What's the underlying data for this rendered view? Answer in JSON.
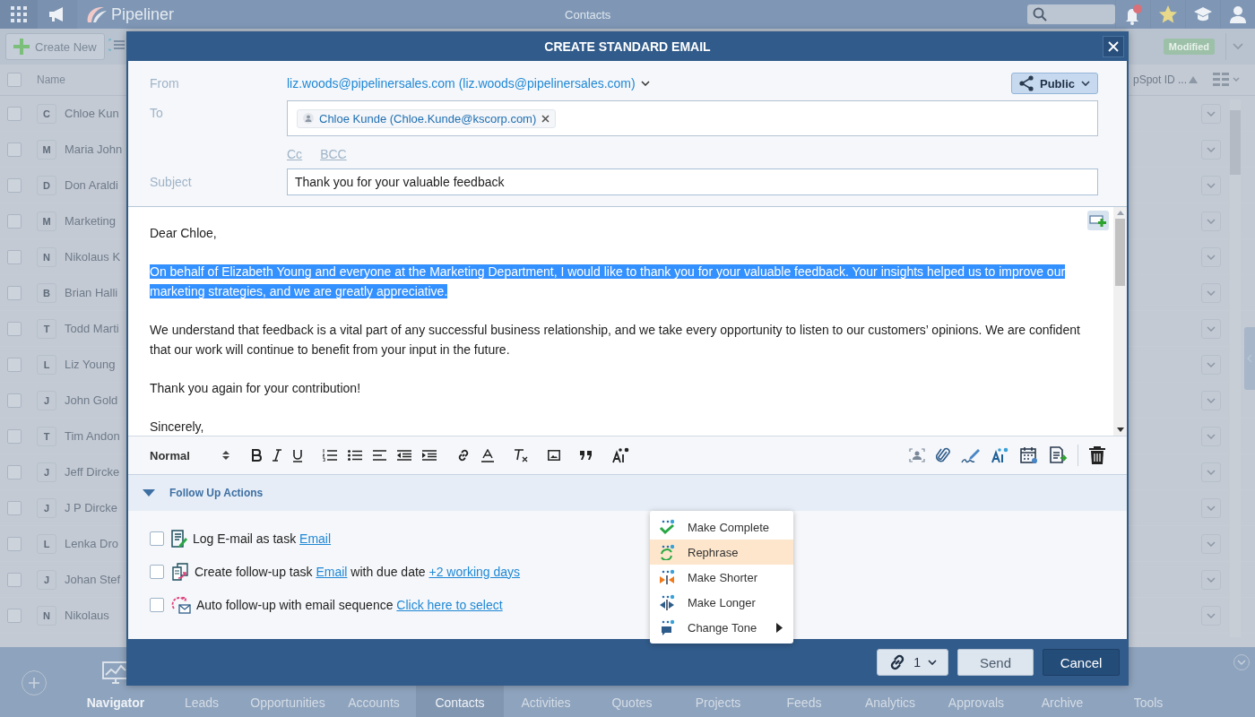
{
  "app": {
    "logo": "Pipeliner",
    "page_title": "Contacts",
    "toolbar": {
      "create_new": "Create New",
      "status": "Modified"
    },
    "list": {
      "select_all_checked": false,
      "name_column": "Name",
      "id_column": "pSpot ID ...",
      "rows": [
        {
          "initial": "C",
          "name": "Chloe Kun",
          "checked": false
        },
        {
          "initial": "M",
          "name": "Maria John",
          "checked": false
        },
        {
          "initial": "D",
          "name": "Don Araldi",
          "checked": false
        },
        {
          "initial": "M",
          "name": "Marketing",
          "checked": false
        },
        {
          "initial": "N",
          "name": "Nikolaus K",
          "checked": false
        },
        {
          "initial": "B",
          "name": "Brian Halli",
          "checked": false
        },
        {
          "initial": "T",
          "name": "Todd Marti",
          "checked": false
        },
        {
          "initial": "L",
          "name": "Liz Young",
          "checked": false
        },
        {
          "initial": "J",
          "name": "John Gold",
          "checked": false
        },
        {
          "initial": "T",
          "name": "Tim Andon",
          "checked": false
        },
        {
          "initial": "J",
          "name": "Jeff Dircke",
          "checked": false
        },
        {
          "initial": "J",
          "name": "J P Dircke",
          "checked": false
        },
        {
          "initial": "L",
          "name": "Lenka Dro",
          "checked": false
        },
        {
          "initial": "J",
          "name": "Johan Stef",
          "checked": false
        },
        {
          "initial": "N",
          "name": "Nikolaus",
          "checked": false
        }
      ]
    },
    "nav": [
      {
        "label": "Navigator",
        "selected": false
      },
      {
        "label": "Leads",
        "selected": false
      },
      {
        "label": "Opportunities",
        "selected": false
      },
      {
        "label": "Accounts",
        "selected": false
      },
      {
        "label": "Contacts",
        "selected": true
      },
      {
        "label": "Activities",
        "selected": false
      },
      {
        "label": "Quotes",
        "selected": false
      },
      {
        "label": "Projects",
        "selected": false
      },
      {
        "label": "Feeds",
        "selected": false
      },
      {
        "label": "Analytics",
        "selected": false
      },
      {
        "label": "Approvals",
        "selected": false
      },
      {
        "label": "Archive",
        "selected": false
      },
      {
        "label": "Tools",
        "selected": false
      }
    ]
  },
  "dialog": {
    "title": "CREATE STANDARD EMAIL",
    "from": {
      "label": "From",
      "value": "liz.woods@pipelinersales.com (liz.woods@pipelinersales.com)"
    },
    "visibility": "Public",
    "to": {
      "label": "To",
      "recipients": [
        "Chloe Kunde (Chloe.Kunde@kscorp.com)"
      ]
    },
    "cc": "Cc",
    "bcc": "BCC",
    "subject": {
      "label": "Subject",
      "value": "Thank you for your valuable feedback"
    },
    "body": [
      {
        "text": "Dear Chloe,",
        "selected": false
      },
      {
        "text": "On behalf of Elizabeth Young and everyone at the Marketing Department, I would like to thank you for your valuable feedback. Your insights helped us to improve our marketing strategies, and we are greatly appreciative.",
        "selected": true
      },
      {
        "text": "We understand that feedback is a vital part of any successful business relationship, and we take every opportunity to listen to our customers’ opinions. We are confident that our work will continue to benefit from your input in the future.",
        "selected": false
      },
      {
        "text": "Thank you again for your contribution!",
        "selected": false
      },
      {
        "text": "Sincerely,",
        "selected": false
      }
    ],
    "format": "Normal",
    "ai_menu": [
      {
        "kind": "complete",
        "label": "Make Complete",
        "selected": false,
        "submenu": false
      },
      {
        "kind": "rephrase",
        "label": "Rephrase",
        "selected": true,
        "submenu": false
      },
      {
        "kind": "shorter",
        "label": "Make Shorter",
        "selected": false,
        "submenu": false
      },
      {
        "kind": "longer",
        "label": "Make Longer",
        "selected": false,
        "submenu": false
      },
      {
        "kind": "tone",
        "label": "Change Tone",
        "selected": false,
        "submenu": true
      }
    ],
    "follow_up": {
      "title": "Follow Up Actions",
      "expanded": true,
      "actions": [
        {
          "kind": "log",
          "checked": false,
          "parts": [
            {
              "text": "Log E-mail as task",
              "link": false
            },
            {
              "text": "Email",
              "link": true
            }
          ]
        },
        {
          "kind": "task",
          "checked": false,
          "parts": [
            {
              "text": "Create follow-up task",
              "link": false
            },
            {
              "text": "Email",
              "link": true
            },
            {
              "text": "with due date",
              "link": false
            },
            {
              "text": "+2 working days",
              "link": true
            }
          ]
        },
        {
          "kind": "sequence",
          "checked": false,
          "parts": [
            {
              "text": "Auto follow-up with email sequence",
              "link": false
            },
            {
              "text": "Click here to select",
              "link": true
            }
          ]
        }
      ]
    },
    "link_count": "1",
    "send": "Send",
    "cancel": "Cancel"
  }
}
